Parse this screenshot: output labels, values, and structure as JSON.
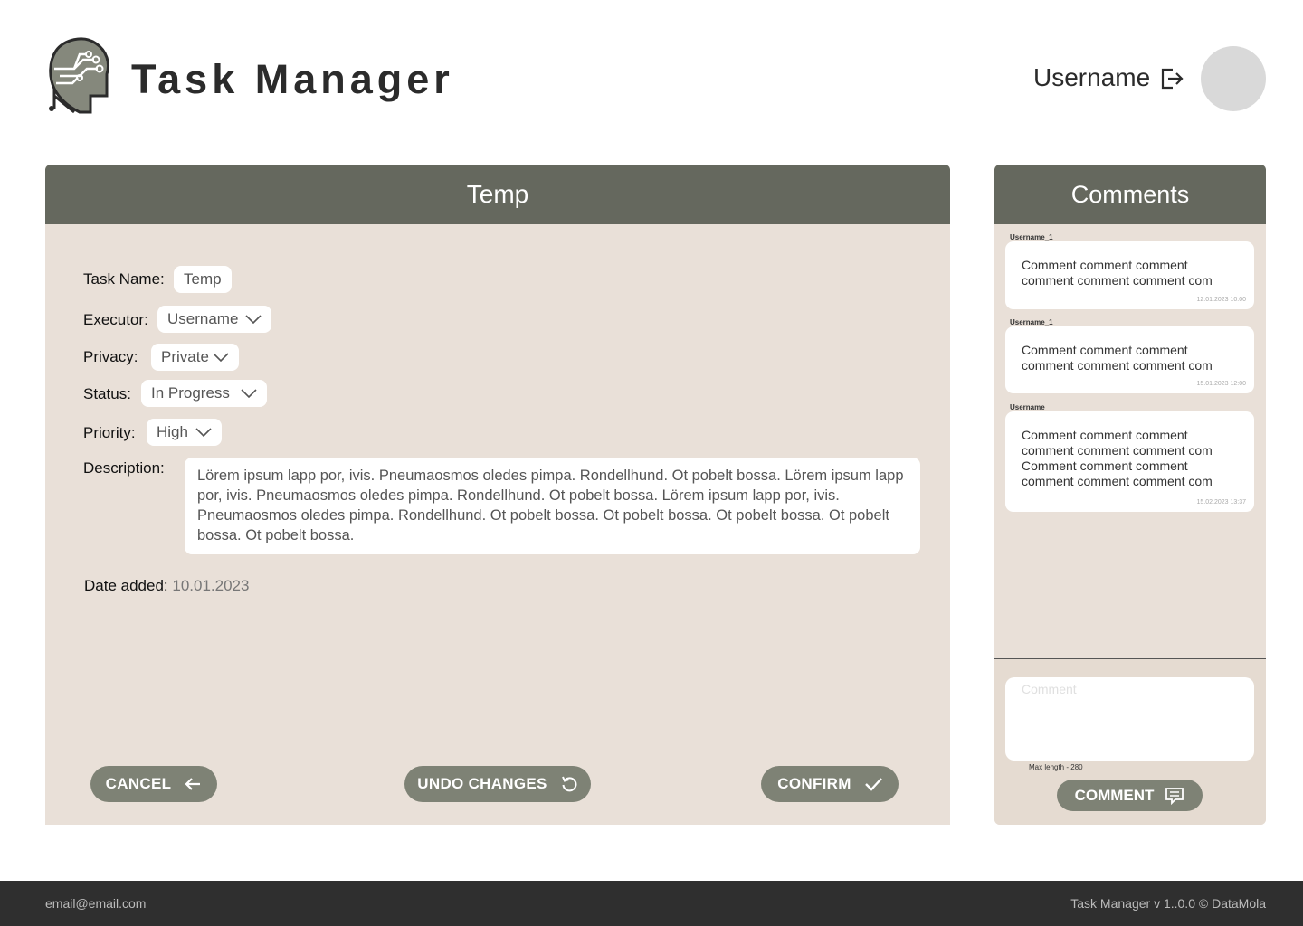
{
  "header": {
    "app_title": "Task Manager",
    "username": "Username"
  },
  "task": {
    "panel_title": "Temp",
    "fields": {
      "task_name": {
        "label": "Task Name:",
        "value": "Temp"
      },
      "executor": {
        "label": "Executor:",
        "value": "Username"
      },
      "privacy": {
        "label": "Privacy:",
        "value": "Private"
      },
      "status": {
        "label": "Status:",
        "value": "In Progress"
      },
      "priority": {
        "label": "Priority:",
        "value": "High"
      },
      "description": {
        "label": "Description:",
        "value": "Lörem ipsum lapp por, ivis. Pneumaosmos oledes pimpa. Rondellhund. Ot pobelt bossa. Lörem ipsum lapp por, ivis. Pneumaosmos oledes pimpa. Rondellhund. Ot pobelt bossa. Lörem ipsum lapp por, ivis. Pneumaosmos oledes pimpa. Rondellhund. Ot pobelt bossa. Ot pobelt bossa. Ot pobelt bossa. Ot pobelt bossa. Ot pobelt bossa."
      },
      "date_added": {
        "label": "Date added:",
        "value": "10.01.2023"
      }
    },
    "buttons": {
      "cancel": "CANCEL",
      "undo": "UNDO CHANGES",
      "confirm": "CONFIRM"
    }
  },
  "comments": {
    "title": "Comments",
    "items": [
      {
        "author": "Username_1",
        "text": "Comment comment comment comment comment comment com",
        "date": "12.01.2023 10:00"
      },
      {
        "author": "Username_1",
        "text": "Comment comment comment comment comment comment com",
        "date": "15.01.2023 12:00"
      },
      {
        "author": "Username",
        "text": "Comment comment comment comment comment comment com Comment comment comment comment comment comment com",
        "date": "15.02.2023 13:37"
      }
    ],
    "input_placeholder": "Comment",
    "max_length": "Max length - 280",
    "submit": "COMMENT"
  },
  "footer": {
    "email": "email@email.com",
    "version": "Task Manager v 1..0.0  © DataMola"
  },
  "colors": {
    "panel_header": "#65685e",
    "panel_bg": "#e9e0d8",
    "button": "#7e8275",
    "footer": "#2f2f2f"
  },
  "icons": {
    "logo": "brain-circuit-head-icon",
    "logout": "logout-icon",
    "chevron": "chevron-down-icon",
    "cancel": "arrow-left-icon",
    "undo": "undo-icon",
    "confirm": "check-icon",
    "comment": "comment-lines-icon"
  }
}
